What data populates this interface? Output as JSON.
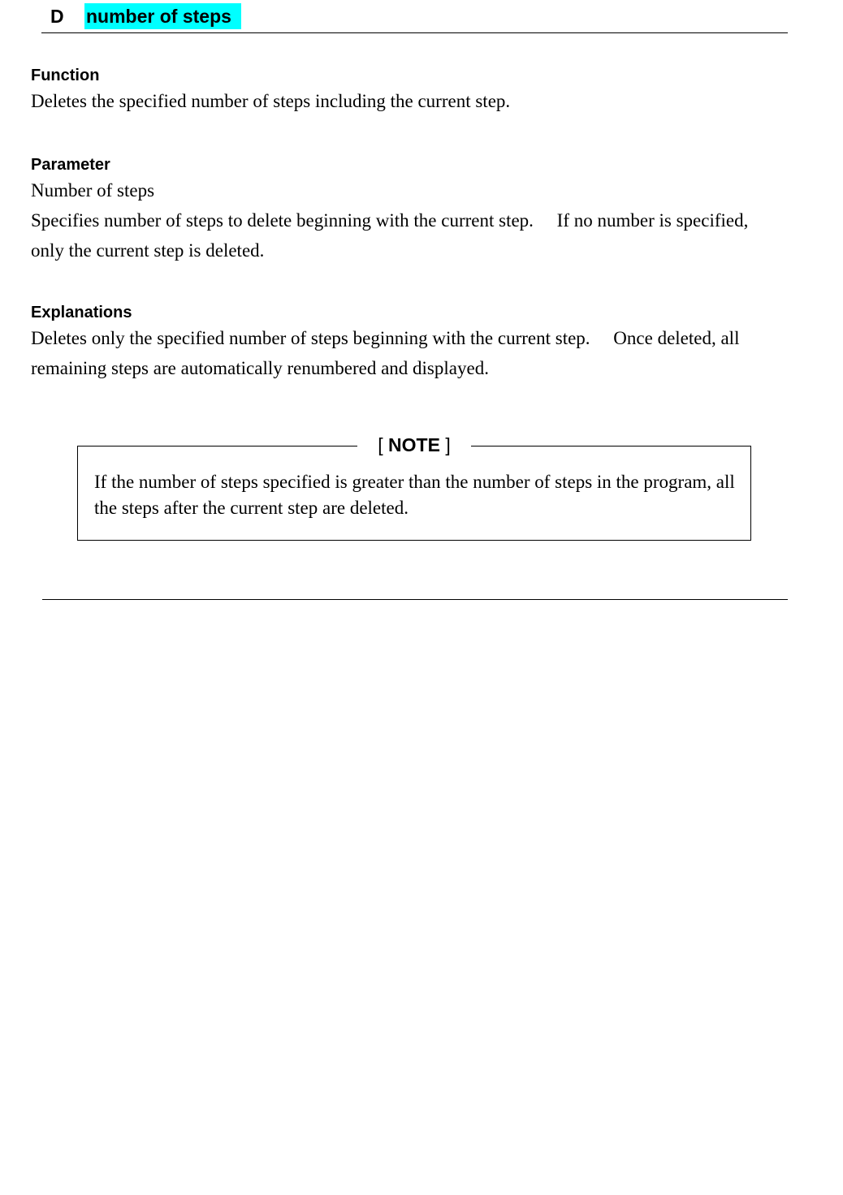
{
  "header": {
    "command_letter": "D",
    "parameter_label": "number of steps"
  },
  "function": {
    "heading": "Function",
    "text": "Deletes the specified number of steps including the current step."
  },
  "parameter": {
    "heading": "Parameter",
    "name": "Number of steps",
    "text": "Specifies number of steps to delete beginning with the current step.  If no number is specified, only the current step is deleted."
  },
  "explanations": {
    "heading": "Explanations",
    "text": "Deletes only the specified number of steps beginning with the current step.  Once deleted, all remaining steps are automatically renumbered and displayed."
  },
  "note": {
    "open_bracket": "[",
    "title": "NOTE",
    "close_bracket": "]",
    "text": "If the number of steps specified is greater than the number of steps in the program, all the steps after the current step are deleted."
  },
  "colors": {
    "highlight": "#00ffff"
  }
}
